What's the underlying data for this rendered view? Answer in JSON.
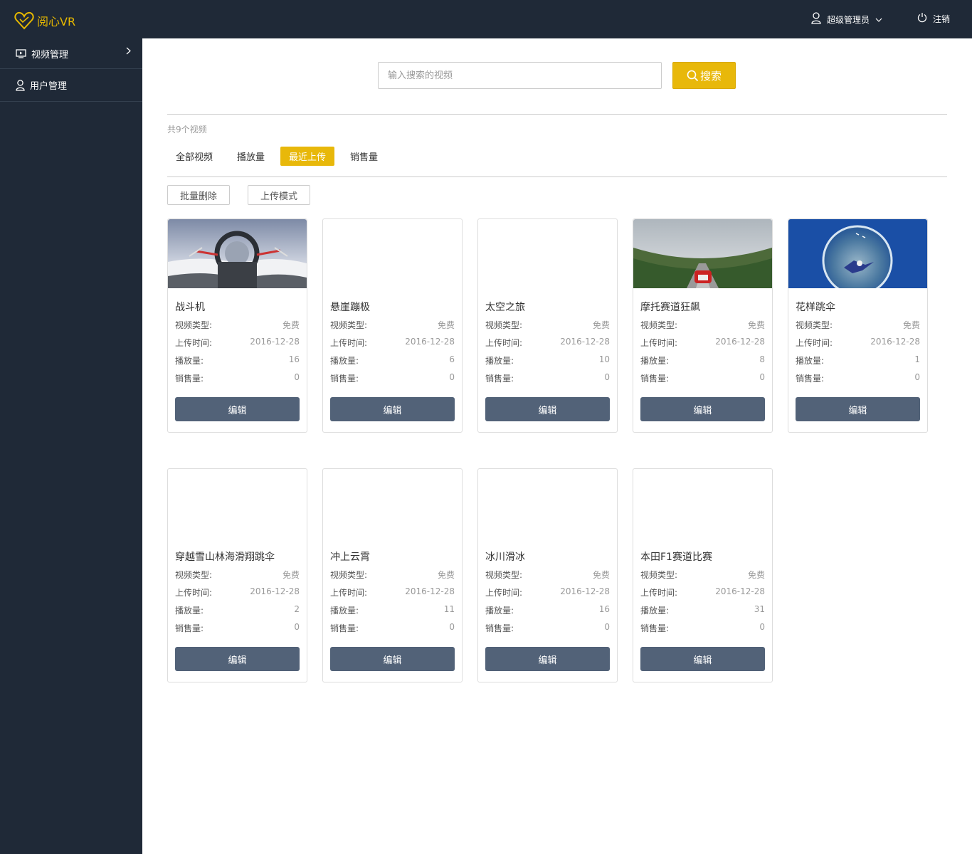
{
  "app": {
    "logo_text": "阅心VR"
  },
  "header": {
    "user_name": "超级管理员",
    "logout_label": "注销"
  },
  "sidebar": {
    "items": [
      {
        "label": "视频管理"
      },
      {
        "label": "用户管理"
      }
    ]
  },
  "search": {
    "placeholder": "输入搜索的视频",
    "button_label": "搜索"
  },
  "summary": {
    "total_text": "共9个视频"
  },
  "tabs": [
    {
      "label": "全部视频",
      "active": false
    },
    {
      "label": "播放量",
      "active": false
    },
    {
      "label": "最近上传",
      "active": true
    },
    {
      "label": "销售量",
      "active": false
    }
  ],
  "actions": {
    "batch_delete": "批量删除",
    "upload_mode": "上传模式"
  },
  "field_labels": {
    "type": "视频类型:",
    "upload_time": "上传时间:",
    "plays": "播放量:",
    "sales": "销售量:"
  },
  "edit_label": "编辑",
  "colors": {
    "accent": "#e8b80a",
    "sidebar_bg": "#1f2937",
    "edit_button": "#526278"
  },
  "videos": [
    {
      "title": "战斗机",
      "type": "免费",
      "upload_time": "2016-12-28",
      "plays": "16",
      "sales": "0",
      "thumbnail": "fighter-jet-cockpit"
    },
    {
      "title": "悬崖蹦极",
      "type": "免费",
      "upload_time": "2016-12-28",
      "plays": "6",
      "sales": "0",
      "thumbnail": ""
    },
    {
      "title": "太空之旅",
      "type": "免费",
      "upload_time": "2016-12-28",
      "plays": "10",
      "sales": "0",
      "thumbnail": ""
    },
    {
      "title": "摩托赛道狂飙",
      "type": "免费",
      "upload_time": "2016-12-28",
      "plays": "8",
      "sales": "0",
      "thumbnail": "motorcycle-track"
    },
    {
      "title": "花样跳伞",
      "type": "免费",
      "upload_time": "2016-12-28",
      "plays": "1",
      "sales": "0",
      "thumbnail": "skydiving-planet"
    },
    {
      "title": "穿越雪山林海滑翔跳伞",
      "type": "免费",
      "upload_time": "2016-12-28",
      "plays": "2",
      "sales": "0",
      "thumbnail": ""
    },
    {
      "title": "冲上云霄",
      "type": "免费",
      "upload_time": "2016-12-28",
      "plays": "11",
      "sales": "0",
      "thumbnail": ""
    },
    {
      "title": "冰川滑冰",
      "type": "免费",
      "upload_time": "2016-12-28",
      "plays": "16",
      "sales": "0",
      "thumbnail": ""
    },
    {
      "title": "本田F1赛道比赛",
      "type": "免费",
      "upload_time": "2016-12-28",
      "plays": "31",
      "sales": "0",
      "thumbnail": ""
    }
  ]
}
